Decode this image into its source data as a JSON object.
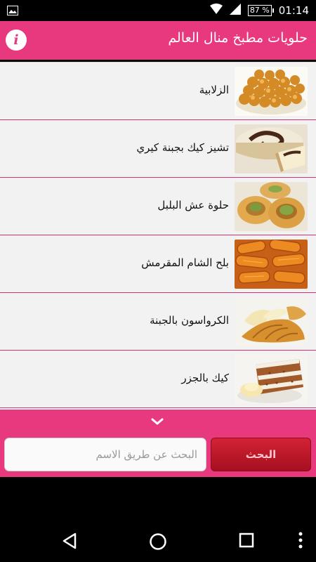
{
  "status_bar": {
    "battery": "87 %",
    "time": "01:14"
  },
  "header": {
    "title": "حلويات مطبخ منال العالم",
    "info_icon": "info-icon"
  },
  "recipes": [
    {
      "label": "الزلابية"
    },
    {
      "label": "تشيز كيك بجبنة كيري"
    },
    {
      "label": "حلوة عش البلبل"
    },
    {
      "label": "بلح الشام المقرمش"
    },
    {
      "label": "الكرواسون بالجبنة"
    },
    {
      "label": "كيك بالجزر"
    }
  ],
  "search": {
    "placeholder": "البحث عن طريق الاسم",
    "button_label": "البحث"
  },
  "colors": {
    "accent": "#e8397f",
    "button": "#c01a2c",
    "divider": "#d52f71"
  }
}
